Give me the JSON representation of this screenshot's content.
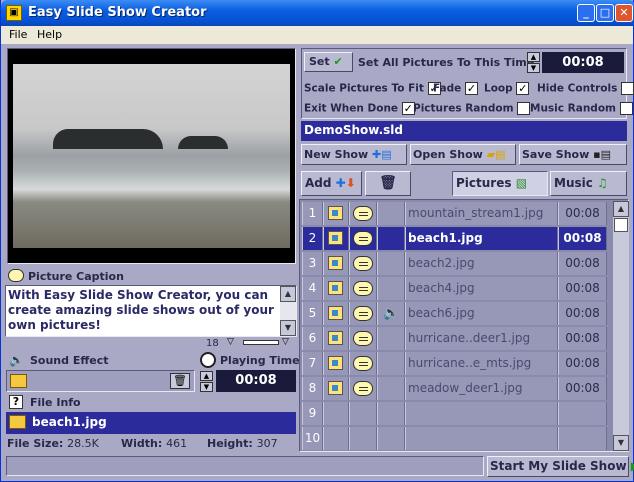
{
  "window": {
    "title": "Easy Slide Show Creator"
  },
  "menu": {
    "file": "File",
    "help": "Help"
  },
  "settings": {
    "set_label": "Set",
    "set_all_label": "Set All Pictures To This Time",
    "set_all_time": "00:08",
    "scale_fit": "Scale Pictures To Fit",
    "fade": "Fade",
    "loop": "Loop",
    "hide_controls": "Hide Controls",
    "exit_when_done": "Exit When Done",
    "pictures_random": "Pictures Random",
    "music_random": "Music Random",
    "scale_fit_checked": true,
    "fade_checked": true,
    "loop_checked": true,
    "hide_controls_checked": false,
    "exit_when_done_checked": true,
    "pictures_random_checked": false,
    "music_random_checked": false
  },
  "show_file": "DemoShow.sld",
  "file_buttons": {
    "new": "New Show",
    "open": "Open Show",
    "save": "Save Show"
  },
  "list_toolbar": {
    "add": "Add",
    "pictures": "Pictures",
    "music": "Music"
  },
  "rows": [
    {
      "num": "1",
      "name": "mountain_stream1.jpg",
      "time": "00:08",
      "sound": false
    },
    {
      "num": "2",
      "name": "beach1.jpg",
      "time": "00:08",
      "sound": false
    },
    {
      "num": "3",
      "name": "beach2.jpg",
      "time": "00:08",
      "sound": false
    },
    {
      "num": "4",
      "name": "beach4.jpg",
      "time": "00:08",
      "sound": false
    },
    {
      "num": "5",
      "name": "beach6.jpg",
      "time": "00:08",
      "sound": true
    },
    {
      "num": "6",
      "name": "hurricane..deer1.jpg",
      "time": "00:08",
      "sound": false
    },
    {
      "num": "7",
      "name": "hurricane..e_mts.jpg",
      "time": "00:08",
      "sound": false
    },
    {
      "num": "8",
      "name": "meadow_deer1.jpg",
      "time": "00:08",
      "sound": false
    },
    {
      "num": "9",
      "name": "",
      "time": "",
      "sound": false
    },
    {
      "num": "10",
      "name": "",
      "time": "",
      "sound": false
    }
  ],
  "caption": {
    "label": "Picture Caption",
    "text": "With Easy Slide Show Creator, you can create amazing slide shows out of your own pictures!",
    "font_size": "18"
  },
  "sound_effect": {
    "label": "Sound Effect"
  },
  "playing_time": {
    "label": "Playing Time",
    "value": "00:08"
  },
  "file_info": {
    "label": "File Info",
    "name": "beach1.jpg",
    "size_label": "File Size:",
    "size": "28.5K",
    "width_label": "Width:",
    "width": "461",
    "height_label": "Height:",
    "height": "307"
  },
  "start_button": "Start My Slide Show"
}
